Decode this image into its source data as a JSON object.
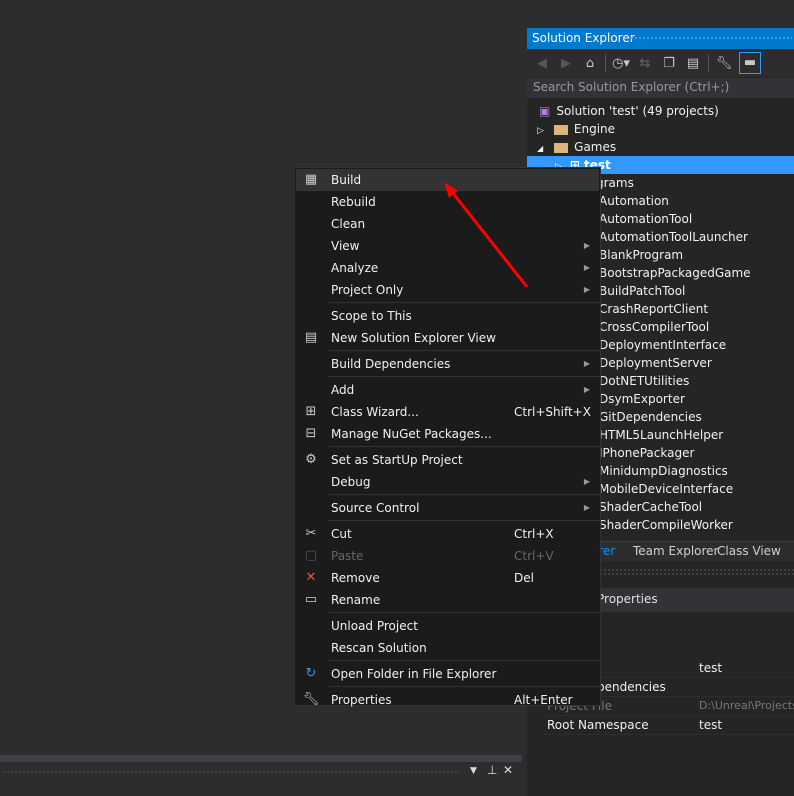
{
  "solution_explorer": {
    "title": "Solution Explorer",
    "search_placeholder": "Search Solution Explorer (Ctrl+;)",
    "toolbar": [
      "back-icon",
      "forward-icon",
      "home-icon",
      "history-icon",
      "sync-icon",
      "collapse-all-icon",
      "show-all-files-icon",
      "properties-wrench-icon",
      "preview-icon"
    ],
    "tree": [
      {
        "label": "Solution 'test' (49 projects)"
      },
      {
        "label": "Engine"
      },
      {
        "label": "Games"
      },
      {
        "label": "test"
      }
    ],
    "tree_partial": [
      "grams",
      "Automation",
      "AutomationTool",
      "AutomationToolLauncher",
      "BlankProgram",
      "BootstrapPackagedGame",
      "BuildPatchTool",
      "CrashReportClient",
      "CrossCompilerTool",
      "DeploymentInterface",
      "DeploymentServer",
      "DotNETUtilities",
      "DsymExporter",
      "GitDependencies",
      "HTML5LaunchHelper",
      "IPhonePackager",
      "MinidumpDiagnostics",
      "MobileDeviceInterface",
      "ShaderCacheTool",
      "ShaderCompileWorker"
    ],
    "tabs": [
      "orer",
      "Team Explorer",
      "Class View"
    ],
    "selection_color": "#3399ff",
    "accent": "#007acc"
  },
  "properties": {
    "title": "Properties",
    "rows": [
      {
        "key": "",
        "value": "test"
      },
      {
        "key": "pendencies",
        "value": ""
      },
      {
        "key": "Project File",
        "value": "D:\\Unreal\\Projects"
      },
      {
        "key": "Root Namespace",
        "value": "test"
      }
    ]
  },
  "context_menu": {
    "groups": [
      [
        {
          "label": "Build",
          "icon": "build-icon",
          "highlighted": true
        },
        {
          "label": "Rebuild"
        },
        {
          "label": "Clean"
        },
        {
          "label": "View",
          "submenu": true
        },
        {
          "label": "Analyze",
          "submenu": true
        },
        {
          "label": "Project Only",
          "submenu": true
        }
      ],
      [
        {
          "label": "Scope to This"
        },
        {
          "label": "New Solution Explorer View",
          "icon": "new-view-icon"
        }
      ],
      [
        {
          "label": "Build Dependencies",
          "submenu": true
        }
      ],
      [
        {
          "label": "Add",
          "submenu": true
        },
        {
          "label": "Class Wizard...",
          "icon": "class-wizard-icon",
          "shortcut": "Ctrl+Shift+X"
        },
        {
          "label": "Manage NuGet Packages...",
          "icon": "nuget-icon"
        }
      ],
      [
        {
          "label": "Set as StartUp Project",
          "icon": "gear-icon"
        },
        {
          "label": "Debug",
          "submenu": true
        }
      ],
      [
        {
          "label": "Source Control",
          "submenu": true
        }
      ],
      [
        {
          "label": "Cut",
          "icon": "scissors-icon",
          "shortcut": "Ctrl+X"
        },
        {
          "label": "Paste",
          "icon": "paste-icon",
          "shortcut": "Ctrl+V",
          "disabled": true
        },
        {
          "label": "Remove",
          "icon": "remove-x-icon",
          "shortcut": "Del"
        },
        {
          "label": "Rename",
          "icon": "rename-icon"
        }
      ],
      [
        {
          "label": "Unload Project"
        },
        {
          "label": "Rescan Solution"
        }
      ],
      [
        {
          "label": "Open Folder in File Explorer",
          "icon": "refresh-arrow-icon"
        }
      ],
      [
        {
          "label": "Properties",
          "icon": "wrench-icon",
          "shortcut": "Alt+Enter"
        }
      ]
    ]
  },
  "bottom_panel": {
    "icons": [
      "dropdown-icon",
      "pin-icon",
      "close-icon"
    ]
  },
  "annotation": {
    "color": "#ff0000"
  }
}
